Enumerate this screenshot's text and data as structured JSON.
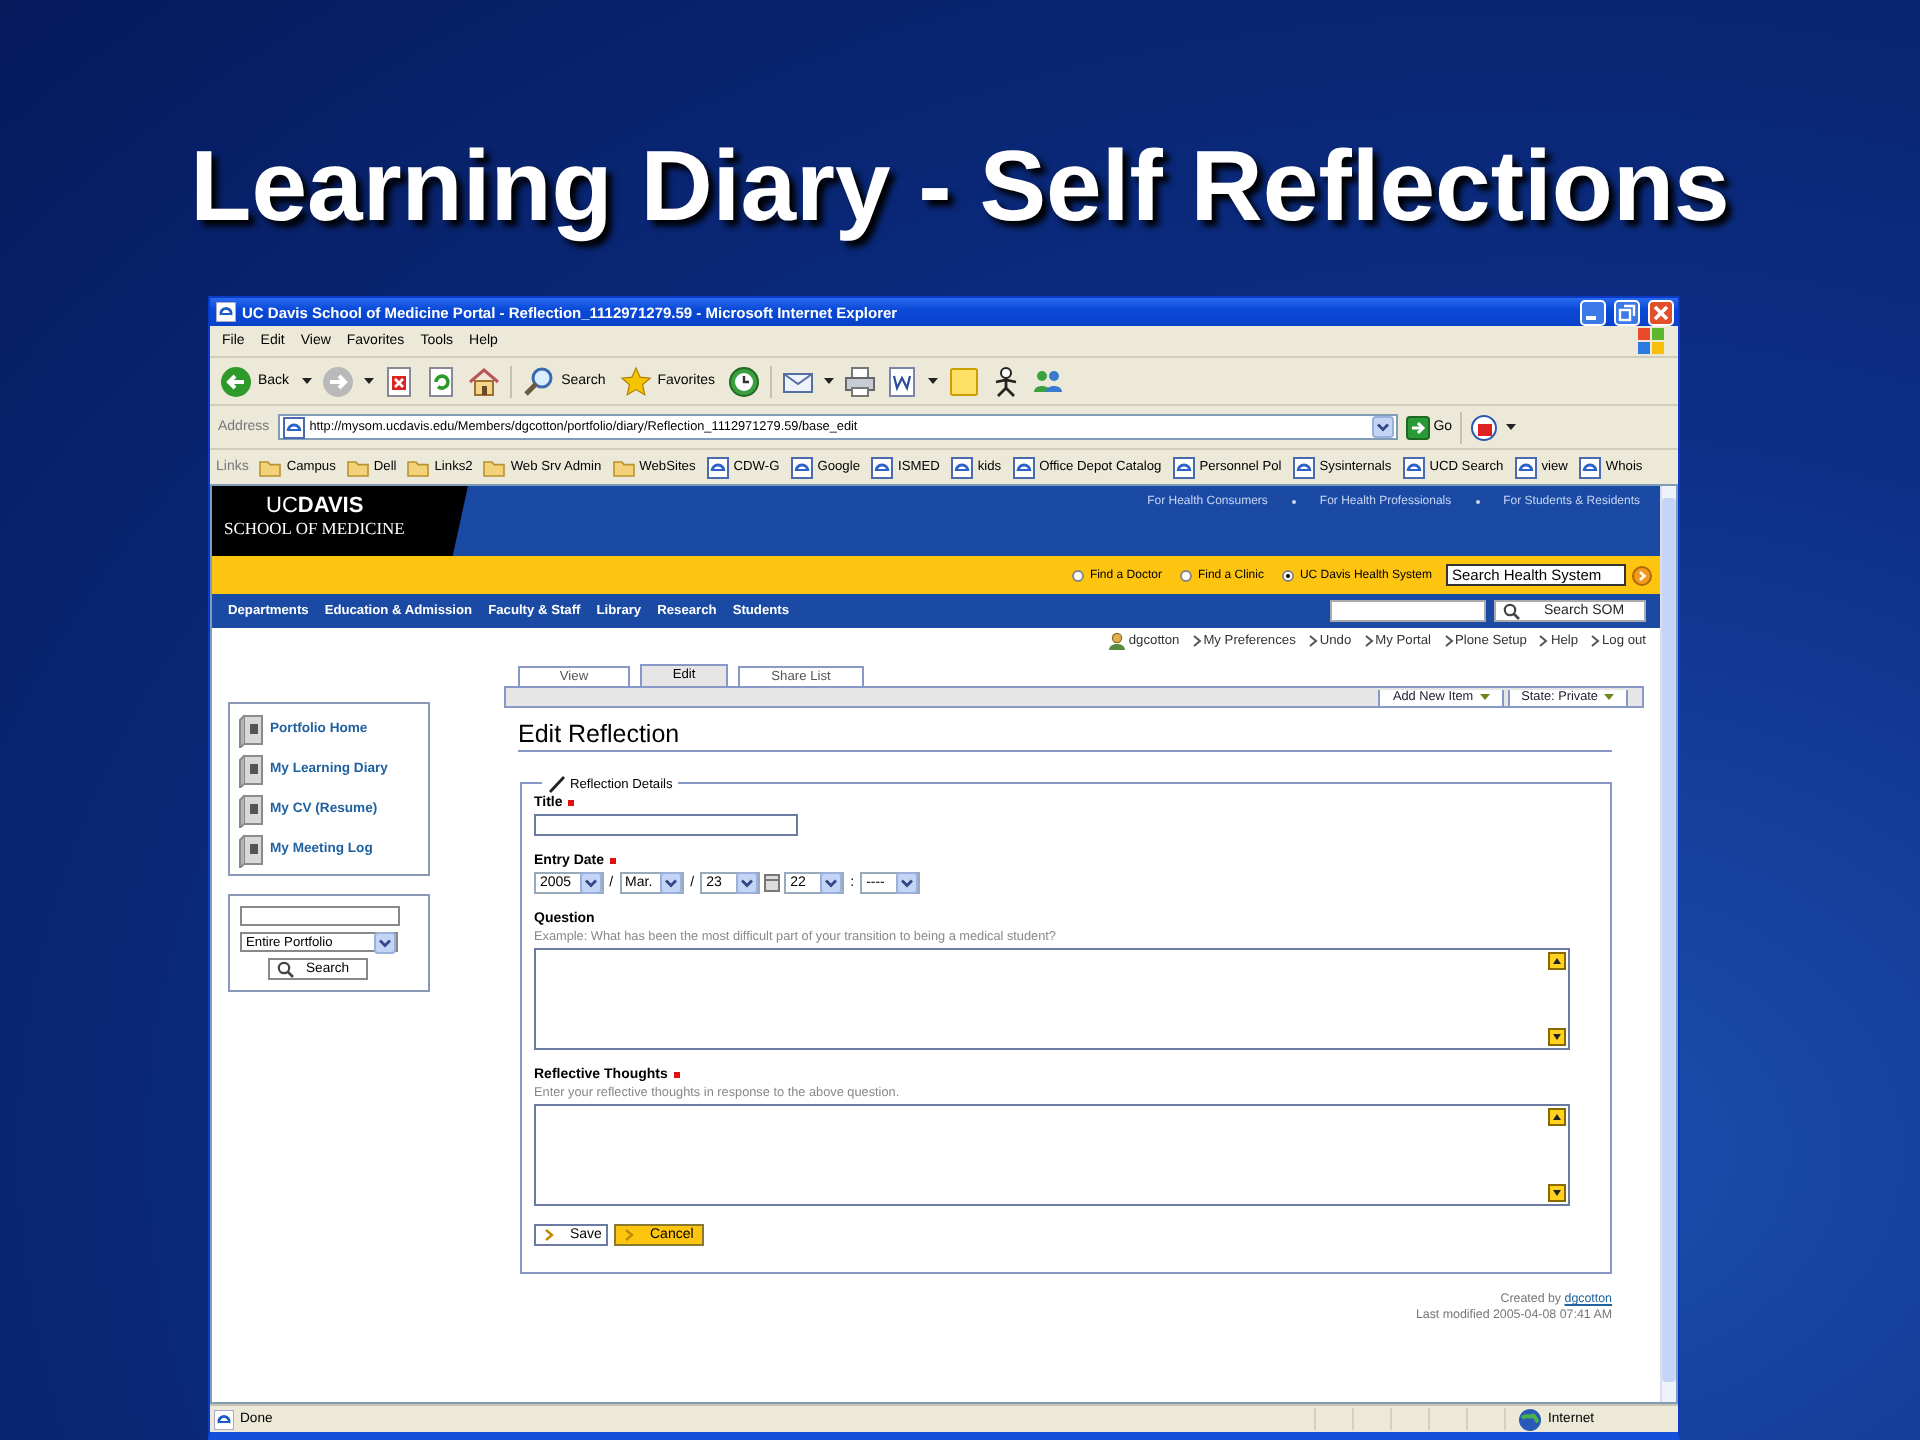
{
  "slide_title": "Learning Diary - Self Reflections",
  "window": {
    "title": "UC Davis School of Medicine Portal - Reflection_1112971279.59 - Microsoft Internet Explorer",
    "menu": [
      "File",
      "Edit",
      "View",
      "Favorites",
      "Tools",
      "Help"
    ],
    "toolbar": [
      "Back",
      "Search",
      "Favorites"
    ],
    "address": {
      "label": "Address",
      "value": "http://mysom.ucdavis.edu/Members/dgcotton/portfolio/diary/Reflection_1112971279.59/base_edit",
      "go": "Go"
    },
    "links": {
      "label": "Links",
      "items": [
        {
          "label": "Campus",
          "kind": "folder"
        },
        {
          "label": "Dell",
          "kind": "folder"
        },
        {
          "label": "Links2",
          "kind": "folder"
        },
        {
          "label": "Web Srv Admin",
          "kind": "folder"
        },
        {
          "label": "WebSites",
          "kind": "folder"
        },
        {
          "label": "CDW-G",
          "kind": "page"
        },
        {
          "label": "Google",
          "kind": "page"
        },
        {
          "label": "ISMED",
          "kind": "page"
        },
        {
          "label": "kids",
          "kind": "page"
        },
        {
          "label": "Office Depot Catalog",
          "kind": "page"
        },
        {
          "label": "Personnel Pol",
          "kind": "page"
        },
        {
          "label": "Sysinternals",
          "kind": "page"
        },
        {
          "label": "UCD Search",
          "kind": "page"
        },
        {
          "label": "view",
          "kind": "page"
        },
        {
          "label": "Whois",
          "kind": "page"
        }
      ]
    },
    "status_bar": {
      "text": "Done",
      "zone": "Internet"
    }
  },
  "page": {
    "header": {
      "wordmark": "UC**DAVIS**",
      "subtitle": "SCHOOL OF MEDICINE",
      "audience_links": [
        "For Health Consumers",
        "For Health Professionals",
        "For Students & Residents"
      ]
    },
    "search_bar": {
      "options": [
        {
          "label": "Find a Doctor",
          "selected": false
        },
        {
          "label": "Find a Clinic",
          "selected": false
        },
        {
          "label": "UC Davis Health System",
          "selected": true
        }
      ],
      "value": "Search Health System"
    },
    "nav": {
      "items": [
        "Departments",
        "Education & Admission",
        "Faculty & Staff",
        "Library",
        "Research",
        "Students"
      ],
      "search_button": "Search SOM"
    },
    "personal_bar": [
      {
        "label": "dgcotton",
        "kind": "user"
      },
      {
        "label": "My Preferences",
        "kind": "link"
      },
      {
        "label": "Undo",
        "kind": "link"
      },
      {
        "label": "My Portal",
        "kind": "link"
      },
      {
        "label": "Plone Setup",
        "kind": "link"
      },
      {
        "label": "Help",
        "kind": "link"
      },
      {
        "label": "Log out",
        "kind": "link"
      }
    ],
    "portfolio_nav": [
      "Portfolio Home",
      "My Learning Diary",
      "My CV (Resume)",
      "My Meeting Log"
    ],
    "portfolio_search": {
      "scope": "Entire Portfolio",
      "button": "Search"
    },
    "tabs": [
      {
        "label": "View",
        "selected": false
      },
      {
        "label": "Edit",
        "selected": true
      },
      {
        "label": "Share List",
        "selected": false
      }
    ],
    "content_actions": [
      "Add New Item",
      "State: Private"
    ],
    "heading": "Edit Reflection",
    "form": {
      "legend": "Reflection Details",
      "fields": [
        {
          "kind": "text",
          "label": "Title",
          "required": true
        },
        {
          "kind": "date",
          "label": "Entry Date",
          "required": true,
          "parts": [
            {
              "kind": "select",
              "value": "2005"
            },
            {
              "kind": "separator",
              "value": "/"
            },
            {
              "kind": "select",
              "value": "Mar."
            },
            {
              "kind": "separator",
              "value": "/"
            },
            {
              "kind": "select",
              "value": "23"
            },
            {
              "kind": "calendar"
            },
            {
              "kind": "select",
              "value": "22"
            },
            {
              "kind": "separator",
              "value": ":"
            },
            {
              "kind": "select",
              "value": "----"
            }
          ]
        },
        {
          "kind": "textarea",
          "label": "Question",
          "required": false,
          "hint": "Example: What has been the most difficult part of your transition to being a medical student?"
        },
        {
          "kind": "textarea",
          "label": "Reflective Thoughts",
          "required": true,
          "hint": "Enter your reflective thoughts in response to the above question."
        }
      ],
      "buttons": [
        {
          "label": "Save",
          "kind": "plain"
        },
        {
          "label": "Cancel",
          "kind": "highlight"
        }
      ]
    },
    "byline": {
      "created_label": "Created by",
      "author": "dgcotton",
      "modified": "Last modified 2005-04-08 07:41 AM"
    }
  }
}
